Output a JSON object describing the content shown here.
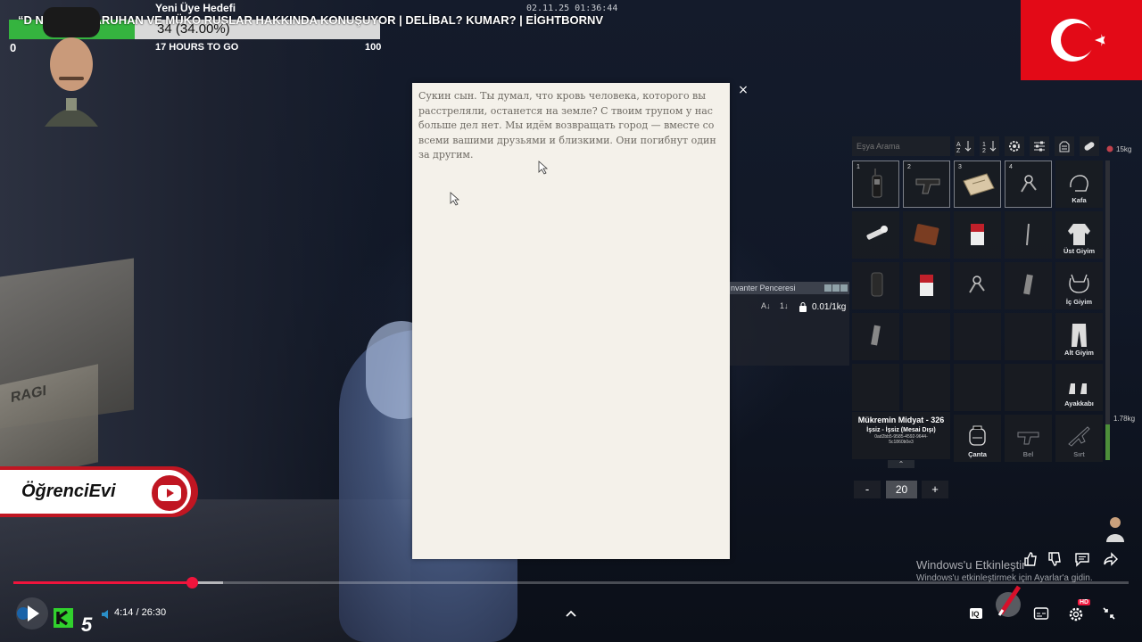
{
  "stream_overlay": {
    "goal_title": "Yeni Üye Hedefi",
    "ticker": "“D         NIYOR! | SARUHAN  VE  MÜKO RUSLAR HAKKINDA KONUŞUYOR | DELİBAL? KUMAR? | EİGHTBORNV",
    "progress_label": "34 (34.00%)",
    "progress_fraction": 0.34,
    "progress_min": "0",
    "progress_max": "100",
    "remaining": "17 HOURS TO GO",
    "timestamp": "02.11.25 01:36:44"
  },
  "note": {
    "text": "Сукин сын. Ты думал, что кровь человека, которого вы расстреляли, останется на земле? С твоим трупом у нас больше дел нет. Мы идём возвращать город — вместе со всеми вашими друзьями и близкими. Они погибнут один за другим.",
    "close_label": "×"
  },
  "second_inventory": {
    "title": "nvanter Penceresi",
    "weight": "0.01/1kg"
  },
  "inventory": {
    "search_placeholder": "Eşya Arama",
    "weight_max": "15kg",
    "weight_current": "1.78kg",
    "weight_fraction": 0.12,
    "hotbar_numbers": [
      "1",
      "2",
      "3",
      "4"
    ],
    "equipment": {
      "head": "Kafa",
      "top": "Üst Giyim",
      "inner": "İç Giyim",
      "bottom": "Alt Giyim",
      "shoes": "Ayakkabı",
      "bag": "Çanta",
      "waist": "Bel",
      "back": "Sırt"
    },
    "player": {
      "name": "Mükremin Midyat - 326",
      "job": "İşsiz - İşsiz (Mesai Dışı)",
      "id": "0ad2bb5-9585-4592-9644-5c1860b0e3"
    },
    "quantity": "20",
    "minus_label": "-",
    "plus_label": "+"
  },
  "channel": {
    "name": "ÖğrenciEvi",
    "badge_number": "5"
  },
  "windows_activation": {
    "title": "Windows'u Etkinleştir",
    "subtitle": "Windows'u etkinleştirmek için Ayarlar'a gidin."
  },
  "player_controls": {
    "current_time": "4:14",
    "separator": " / ",
    "total_time": "26:30",
    "played_fraction": 0.1597,
    "hd_badge": "HD"
  },
  "colors": {
    "accent_red": "#f0143c",
    "flag_red": "#e30a17",
    "progress_green": "#35b43f",
    "paper": "#f4f1ea"
  }
}
